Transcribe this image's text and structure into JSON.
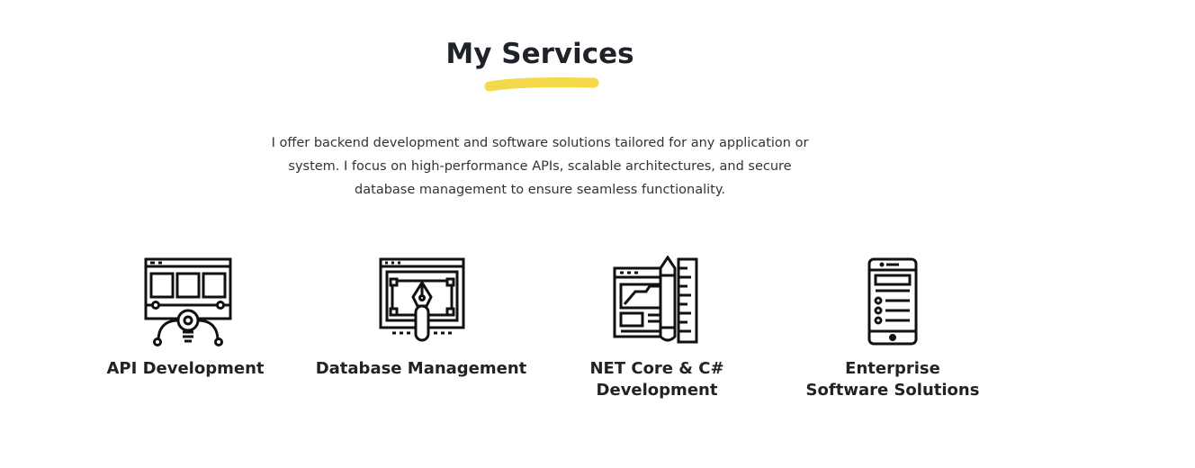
{
  "section": {
    "title": "My Services",
    "accent_color": "#f4d94a",
    "description": "I offer backend development and software solutions tailored for any application or system. I focus on high-performance APIs, scalable architectures, and secure database management to ensure seamless functionality."
  },
  "services": [
    {
      "label": "API Development",
      "icon": "api-wireframe-icon"
    },
    {
      "label": "Database Management",
      "icon": "vector-pen-tool-icon"
    },
    {
      "label": "NET Core & C# Development",
      "icon": "design-tools-icon"
    },
    {
      "label": "Enterprise Software Solutions",
      "icon": "mobile-app-icon"
    }
  ]
}
